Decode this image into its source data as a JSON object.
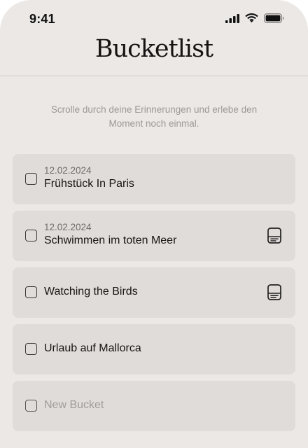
{
  "status_bar": {
    "time": "9:41"
  },
  "header": {
    "title": "Bucketlist"
  },
  "intro": {
    "text": "Scrolle durch deine Erinnerungen und erlebe den Moment noch einmal."
  },
  "buckets": [
    {
      "date": "12.02.2024",
      "title": "Frühstück In Paris",
      "has_note": false
    },
    {
      "date": "12.02.2024",
      "title": "Schwimmen im toten Meer",
      "has_note": true
    },
    {
      "date": "",
      "title": "Watching the Birds",
      "has_note": true
    },
    {
      "date": "",
      "title": "Urlaub auf Mallorca",
      "has_note": false
    }
  ],
  "new_bucket": {
    "placeholder": "New Bucket"
  },
  "colors": {
    "background": "#ece8e5",
    "card": "#e0dcd9",
    "text": "#161413",
    "muted_text": "#9c9896"
  },
  "icons": {
    "signal": "cellular-signal-icon",
    "wifi": "wifi-icon",
    "battery": "battery-icon",
    "checkbox": "checkbox-icon",
    "note": "note-icon"
  }
}
